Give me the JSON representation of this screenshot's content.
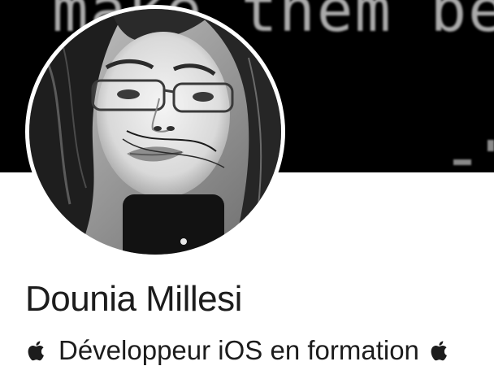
{
  "profile": {
    "banner_text": "make them bette",
    "name": "Dounia Millesi",
    "bio": "Développeur iOS en formation",
    "bio_icon": "apple-logo-icon"
  }
}
